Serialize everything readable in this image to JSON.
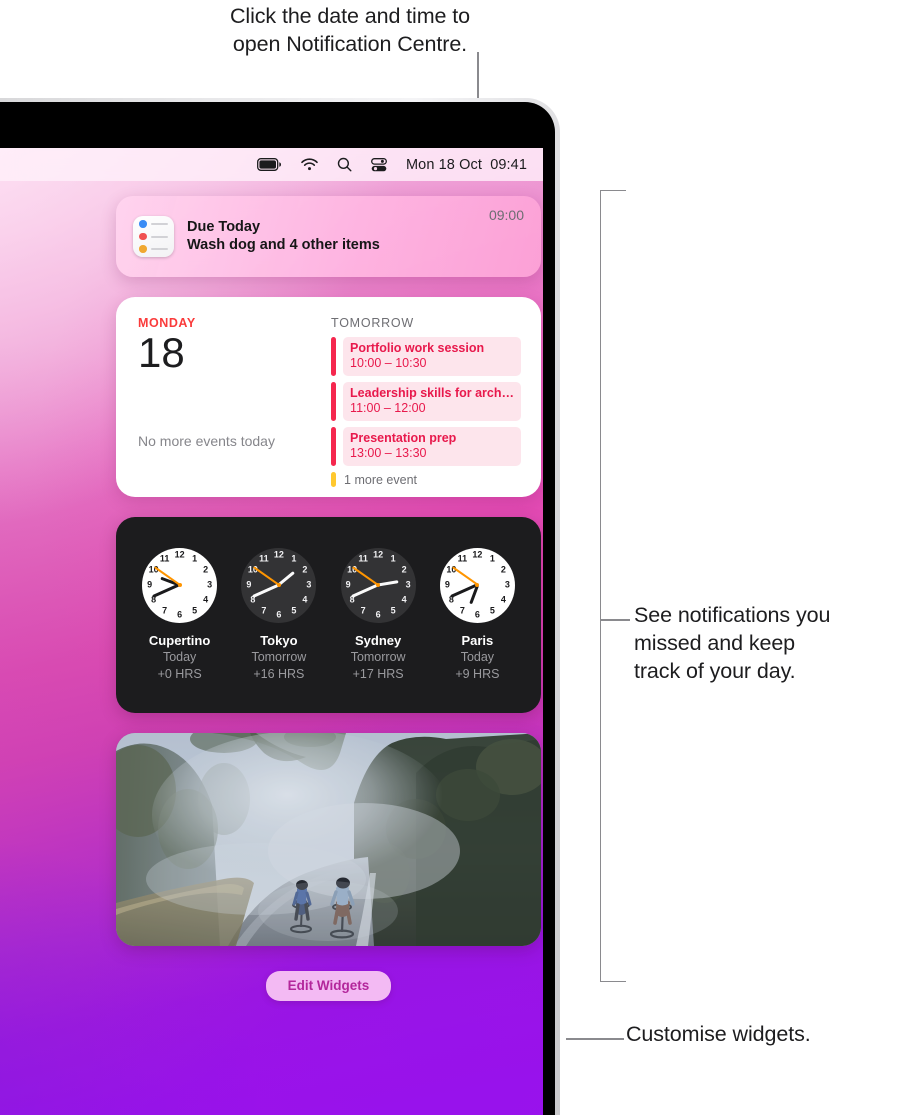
{
  "callouts": {
    "top": "Click the date and time to\nopen Notification Centre.",
    "right_main": "See notifications you\nmissed and keep\ntrack of your day.",
    "right_bottom": "Customise widgets."
  },
  "menubar": {
    "icons": [
      "battery-icon",
      "wifi-icon",
      "search-icon",
      "control-centre-icon"
    ],
    "datetime": "Mon 18 Oct  09:41"
  },
  "notification": {
    "app_icon": "reminders-icon",
    "title": "Due Today",
    "body": "Wash dog and 4 other items",
    "time": "09:00",
    "icon_dot_colors": [
      "#3a8cf5",
      "#f05050",
      "#f0a830"
    ]
  },
  "calendar": {
    "weekday": "MONDAY",
    "date": "18",
    "no_more_events": "No more events today",
    "section_label": "TOMORROW",
    "accent_color": "#e8194c",
    "more_accent_color": "#ffc82e",
    "events": [
      {
        "name": "Portfolio work session",
        "time": "10:00 – 10:30"
      },
      {
        "name": "Leadership skills for arch…",
        "time": "11:00 – 12:00"
      },
      {
        "name": "Presentation prep",
        "time": "13:00 – 13:30"
      }
    ],
    "more_events": "1 more event"
  },
  "worldclock": {
    "clocks": [
      {
        "city": "Cupertino",
        "day": "Today",
        "offset": "+0 HRS",
        "theme": "light",
        "hour_deg": 290.5,
        "minute_deg": 246,
        "second_deg": 305
      },
      {
        "city": "Tokyo",
        "day": "Tomorrow",
        "offset": "+16 HRS",
        "theme": "dark",
        "hour_deg": 50.5,
        "minute_deg": 246,
        "second_deg": 305
      },
      {
        "city": "Sydney",
        "day": "Tomorrow",
        "offset": "+17 HRS",
        "theme": "dark",
        "hour_deg": 80.5,
        "minute_deg": 246,
        "second_deg": 305
      },
      {
        "city": "Paris",
        "day": "Today",
        "offset": "+9 HRS",
        "theme": "light",
        "hour_deg": 200.5,
        "minute_deg": 246,
        "second_deg": 305
      }
    ],
    "numerals": [
      "12",
      "1",
      "2",
      "3",
      "4",
      "5",
      "6",
      "7",
      "8",
      "9",
      "10",
      "11"
    ],
    "second_hand_color": "#ff9500"
  },
  "photo": {
    "description": "two cyclists riding on a misty forest road"
  },
  "edit_widgets_button": "Edit Widgets",
  "colors": {
    "wallpaper_top": "#f7d8ec",
    "wallpaper_mid": "#d94cae",
    "wallpaper_bottom": "#9a10ee",
    "calendar_red": "#fa3b3b",
    "button_text": "#b3269b"
  }
}
